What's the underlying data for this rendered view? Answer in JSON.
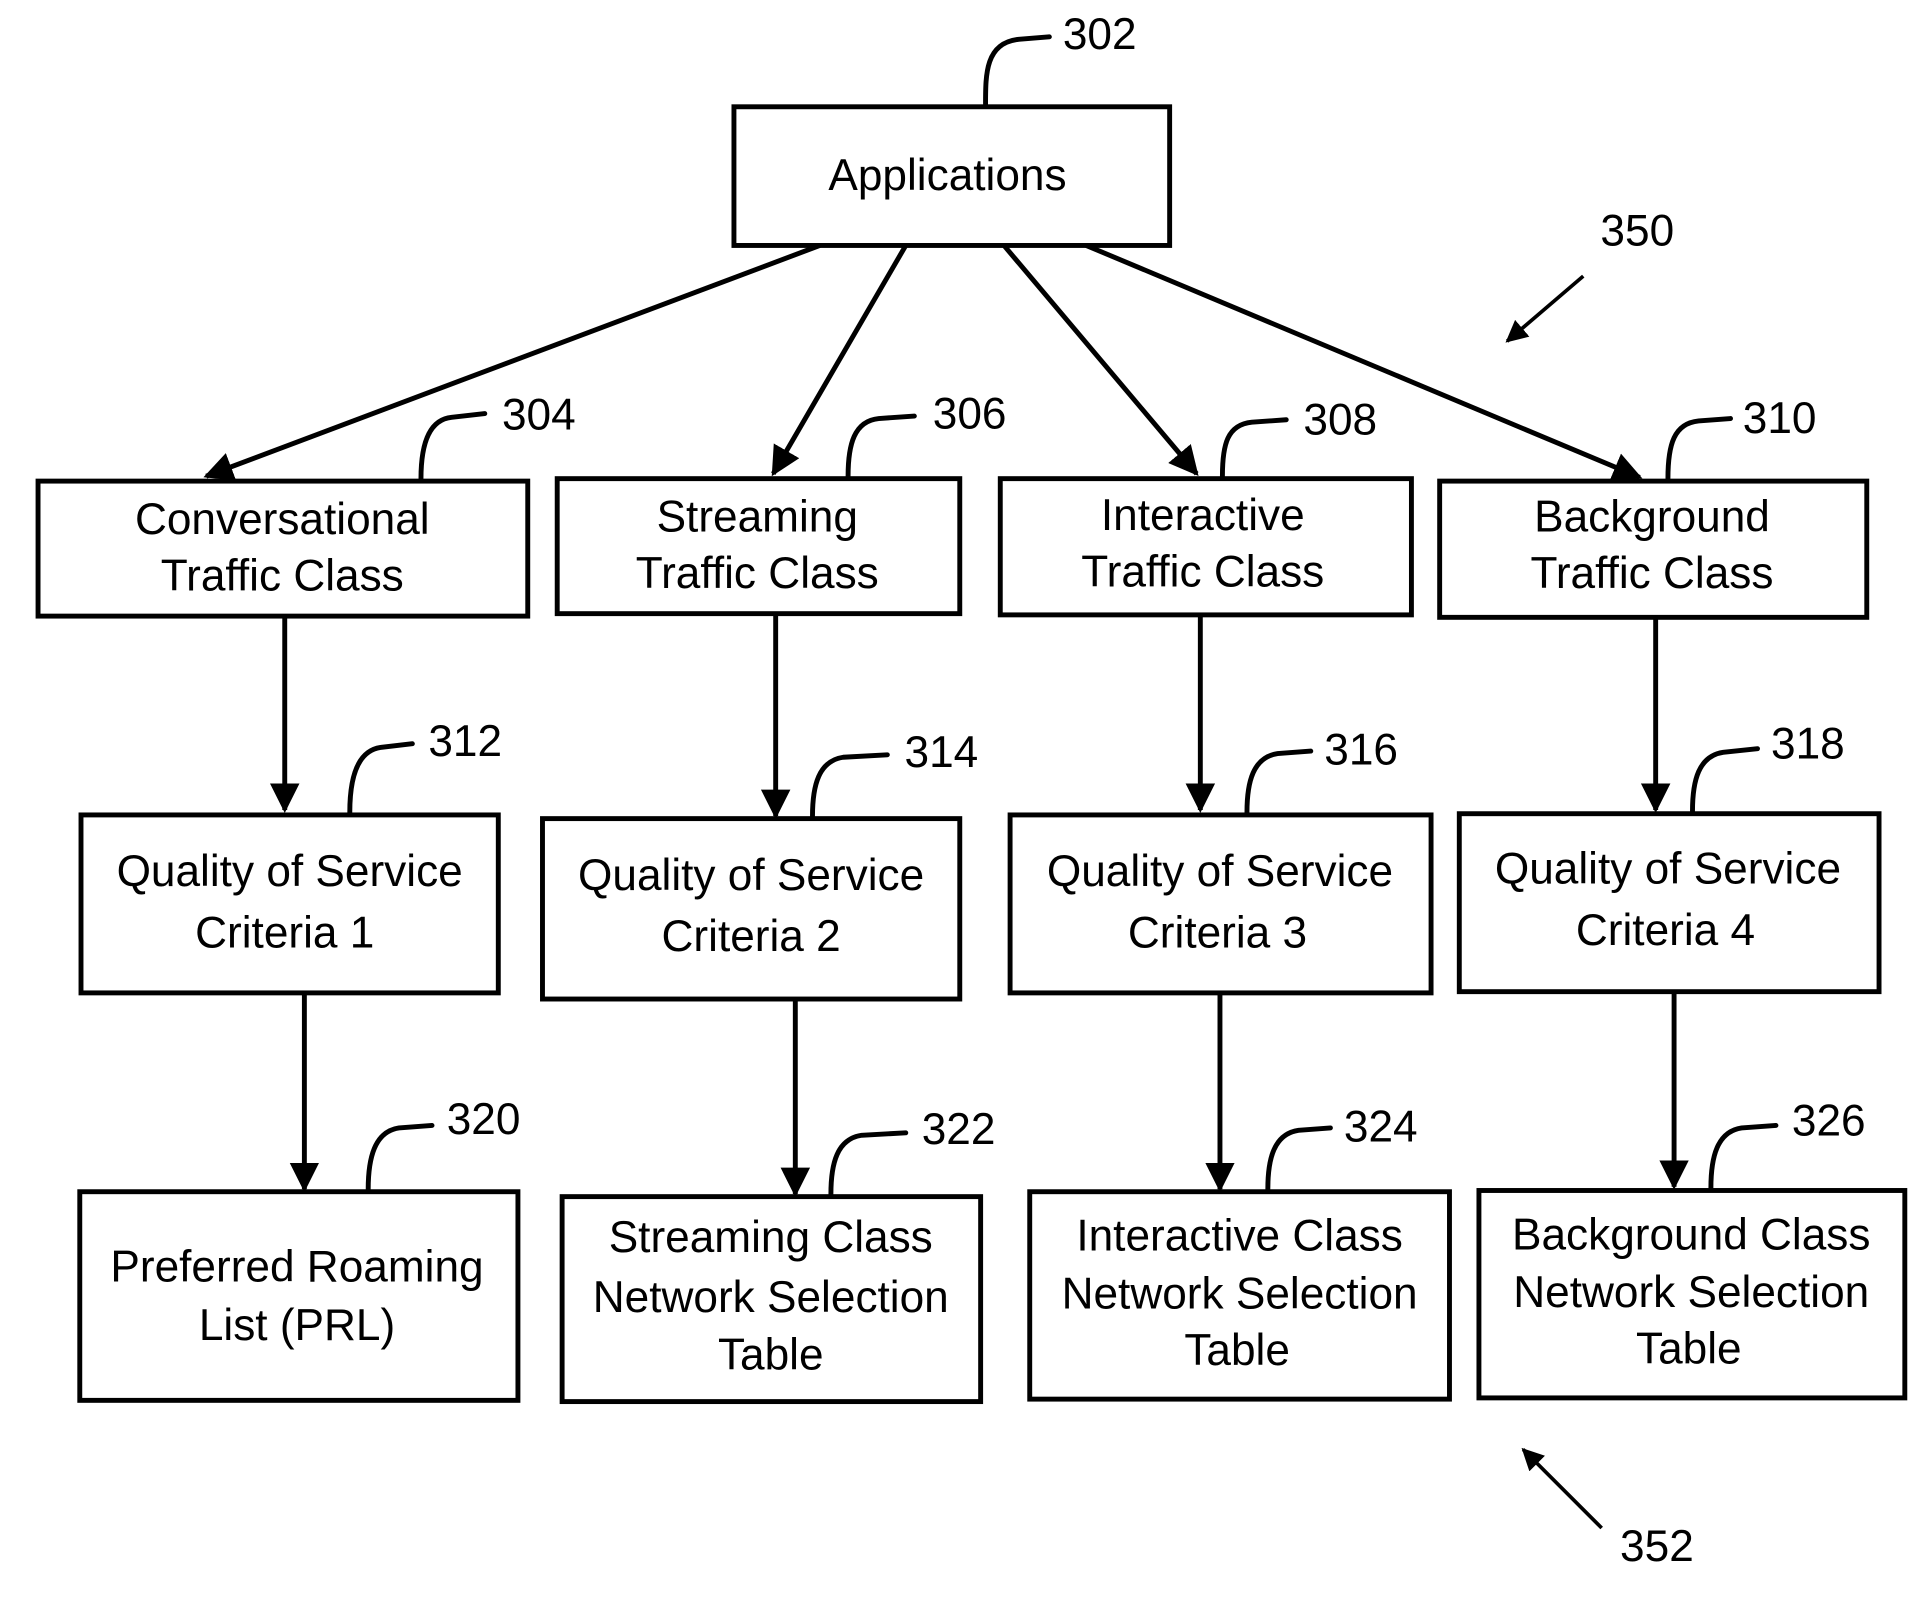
{
  "diagram": {
    "root": {
      "id": "302",
      "lines": [
        "Applications"
      ]
    },
    "traffic_classes": [
      {
        "id": "304",
        "lines": [
          "Conversational",
          "Traffic Class"
        ]
      },
      {
        "id": "306",
        "lines": [
          "Streaming",
          "Traffic Class"
        ]
      },
      {
        "id": "308",
        "lines": [
          "Interactive",
          "Traffic Class"
        ]
      },
      {
        "id": "310",
        "lines": [
          "Background",
          "Traffic Class"
        ]
      }
    ],
    "qos_criteria": [
      {
        "id": "312",
        "lines": [
          "Quality of Service",
          "Criteria 1"
        ]
      },
      {
        "id": "314",
        "lines": [
          "Quality of Service",
          "Criteria 2"
        ]
      },
      {
        "id": "316",
        "lines": [
          "Quality of Service",
          "Criteria 3"
        ]
      },
      {
        "id": "318",
        "lines": [
          "Quality of Service",
          "Criteria 4"
        ]
      }
    ],
    "selection_tables": [
      {
        "id": "320",
        "lines": [
          "Preferred Roaming",
          "List (PRL)"
        ]
      },
      {
        "id": "322",
        "lines": [
          "Streaming Class",
          "Network Selection",
          "Table"
        ]
      },
      {
        "id": "324",
        "lines": [
          "Interactive Class",
          "Network Selection",
          "Table"
        ]
      },
      {
        "id": "326",
        "lines": [
          "Background Class",
          "Network Selection",
          "Table"
        ]
      }
    ],
    "group_refs": [
      {
        "id": "350",
        "label": "350"
      },
      {
        "id": "352",
        "label": "352"
      }
    ]
  }
}
